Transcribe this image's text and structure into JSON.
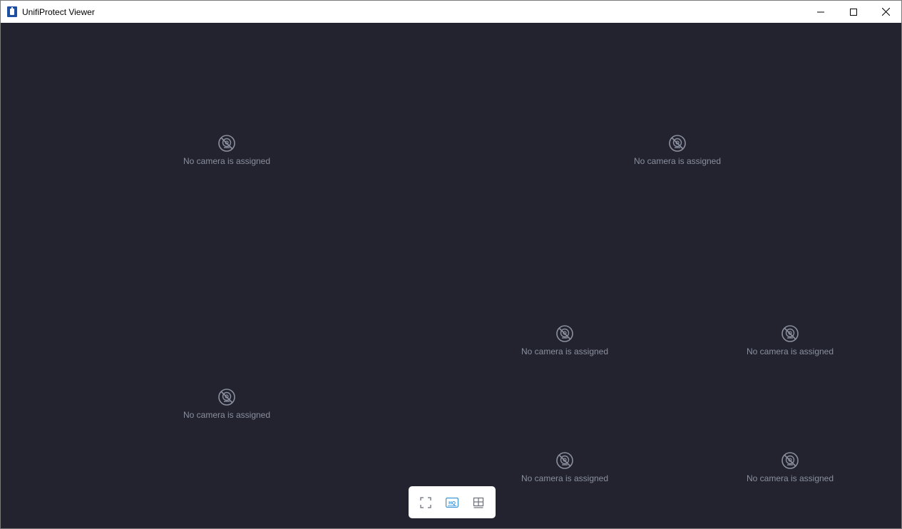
{
  "window": {
    "title": "UnifiProtect Viewer",
    "controls": [
      "minimize",
      "maximize",
      "close"
    ]
  },
  "grid": {
    "slots": [
      {
        "label": "No camera is assigned",
        "icon": "camera-off-icon"
      },
      {
        "label": "No camera is assigned",
        "icon": "camera-off-icon"
      },
      {
        "label": "No camera is assigned",
        "icon": "camera-off-icon"
      },
      {
        "label": "No camera is assigned",
        "icon": "camera-off-icon"
      },
      {
        "label": "No camera is assigned",
        "icon": "camera-off-icon"
      },
      {
        "label": "No camera is assigned",
        "icon": "camera-off-icon"
      },
      {
        "label": "No camera is assigned",
        "icon": "camera-off-icon"
      }
    ]
  },
  "toolbar": {
    "buttons": [
      {
        "name": "fullscreen",
        "icon": "fullscreen-icon"
      },
      {
        "name": "hq",
        "icon": "hq-icon",
        "text": "HQ",
        "active": true
      },
      {
        "name": "layout",
        "icon": "grid-layout-icon"
      }
    ]
  },
  "colors": {
    "background": "#22232f",
    "placeholder_text": "#8b8f9e",
    "accent": "#2f8fd8",
    "titlebar": "#ffffff"
  }
}
